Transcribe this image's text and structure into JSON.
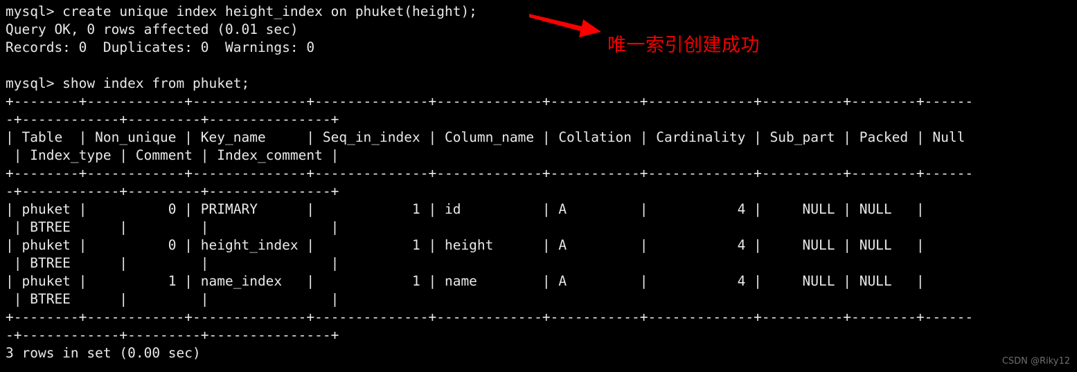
{
  "terminal": {
    "title": "MySQL Terminal",
    "background_color": "#000000",
    "text_color": "#e9e9e9",
    "prompt": "mysql>",
    "lines": [
      "mysql> create unique index height_index on phuket(height);",
      "Query OK, 0 rows affected (0.01 sec)",
      "Records: 0  Duplicates: 0  Warnings: 0",
      "",
      "mysql> show index from phuket;",
      "+--------+------------+--------------+--------------+-------------+-----------+-------------+----------+--------+------",
      "-+------------+---------+---------------+",
      "| Table  | Non_unique | Key_name     | Seq_in_index | Column_name | Collation | Cardinality | Sub_part | Packed | Null",
      " | Index_type | Comment | Index_comment |",
      "+--------+------------+--------------+--------------+-------------+-----------+-------------+----------+--------+------",
      "-+------------+---------+---------------+",
      "| phuket |          0 | PRIMARY      |            1 | id          | A         |           4 |     NULL | NULL   |",
      " | BTREE      |         |               |",
      "| phuket |          0 | height_index |            1 | height      | A         |           4 |     NULL | NULL   |",
      " | BTREE      |         |               |",
      "| phuket |          1 | name_index   |            1 | name        | A         |           4 |     NULL | NULL   |",
      " | BTREE      |         |               |",
      "+--------+------------+--------------+--------------+-------------+-----------+-------------+----------+--------+------",
      "-+------------+---------+---------------+",
      "3 rows in set (0.00 sec)"
    ]
  },
  "commands": {
    "create_index": "create unique index height_index on phuket(height);",
    "show_index": "show index from phuket;",
    "result_query_ok": "Query OK, 0 rows affected (0.01 sec)",
    "result_records": "Records: 0  Duplicates: 0  Warnings: 0",
    "result_rows": "3 rows in set (0.00 sec)"
  },
  "index_table": {
    "columns": [
      "Table",
      "Non_unique",
      "Key_name",
      "Seq_in_index",
      "Column_name",
      "Collation",
      "Cardinality",
      "Sub_part",
      "Packed",
      "Null",
      "Index_type",
      "Comment",
      "Index_comment"
    ],
    "rows": [
      {
        "Table": "phuket",
        "Non_unique": "0",
        "Key_name": "PRIMARY",
        "Seq_in_index": "1",
        "Column_name": "id",
        "Collation": "A",
        "Cardinality": "4",
        "Sub_part": "NULL",
        "Packed": "NULL",
        "Null": "",
        "Index_type": "BTREE",
        "Comment": "",
        "Index_comment": ""
      },
      {
        "Table": "phuket",
        "Non_unique": "0",
        "Key_name": "height_index",
        "Seq_in_index": "1",
        "Column_name": "height",
        "Collation": "A",
        "Cardinality": "4",
        "Sub_part": "NULL",
        "Packed": "NULL",
        "Null": "",
        "Index_type": "BTREE",
        "Comment": "",
        "Index_comment": ""
      },
      {
        "Table": "phuket",
        "Non_unique": "1",
        "Key_name": "name_index",
        "Seq_in_index": "1",
        "Column_name": "name",
        "Collation": "A",
        "Cardinality": "4",
        "Sub_part": "NULL",
        "Packed": "NULL",
        "Null": "",
        "Index_type": "BTREE",
        "Comment": "",
        "Index_comment": ""
      }
    ],
    "row_count_text": "3 rows in set (0.00 sec)"
  },
  "annotation": {
    "text": "唯一索引创建成功",
    "color": "#f50000",
    "arrow_name": "red-arrow"
  },
  "watermark": {
    "text": "CSDN @Riky12",
    "color": "#6e6e6e"
  }
}
